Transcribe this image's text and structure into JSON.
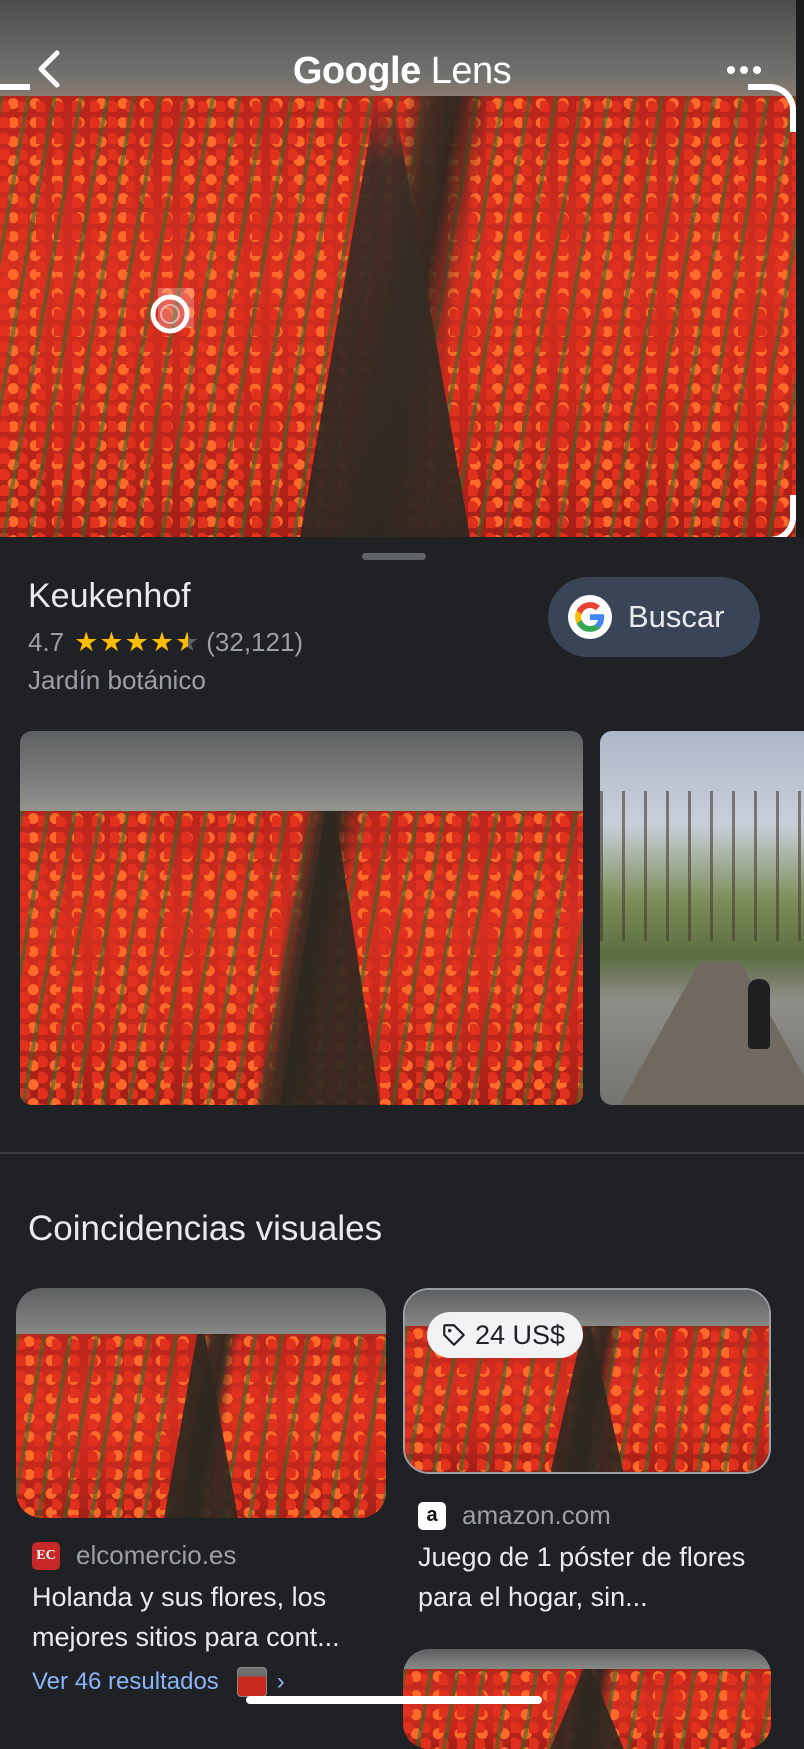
{
  "header": {
    "logo_google": "Google",
    "logo_lens": "Lens",
    "back_icon": "chevron-left-icon",
    "more_icon": "more-horizontal-icon"
  },
  "place": {
    "name": "Keukenhof",
    "rating": "4.7",
    "rating_value": 4.7,
    "reviews": "(32,121)",
    "category": "Jardín botánico",
    "search_button": "Buscar"
  },
  "visual_matches": {
    "title": "Coincidencias visuales",
    "items": [
      {
        "source": "elcomercio.es",
        "favicon_text": "EC",
        "description": "Holanda y sus flores, los mejores sitios para cont..."
      },
      {
        "source": "amazon.com",
        "favicon_text": "a",
        "price": "24 US$",
        "description": "Juego de 1 póster de flores para el hogar, sin..."
      }
    ],
    "see_more": "Ver 46 resultados"
  },
  "colors": {
    "background": "#202124",
    "accent_link": "#8ab4f8",
    "button_bg": "#394457",
    "star": "#fbbc04"
  }
}
